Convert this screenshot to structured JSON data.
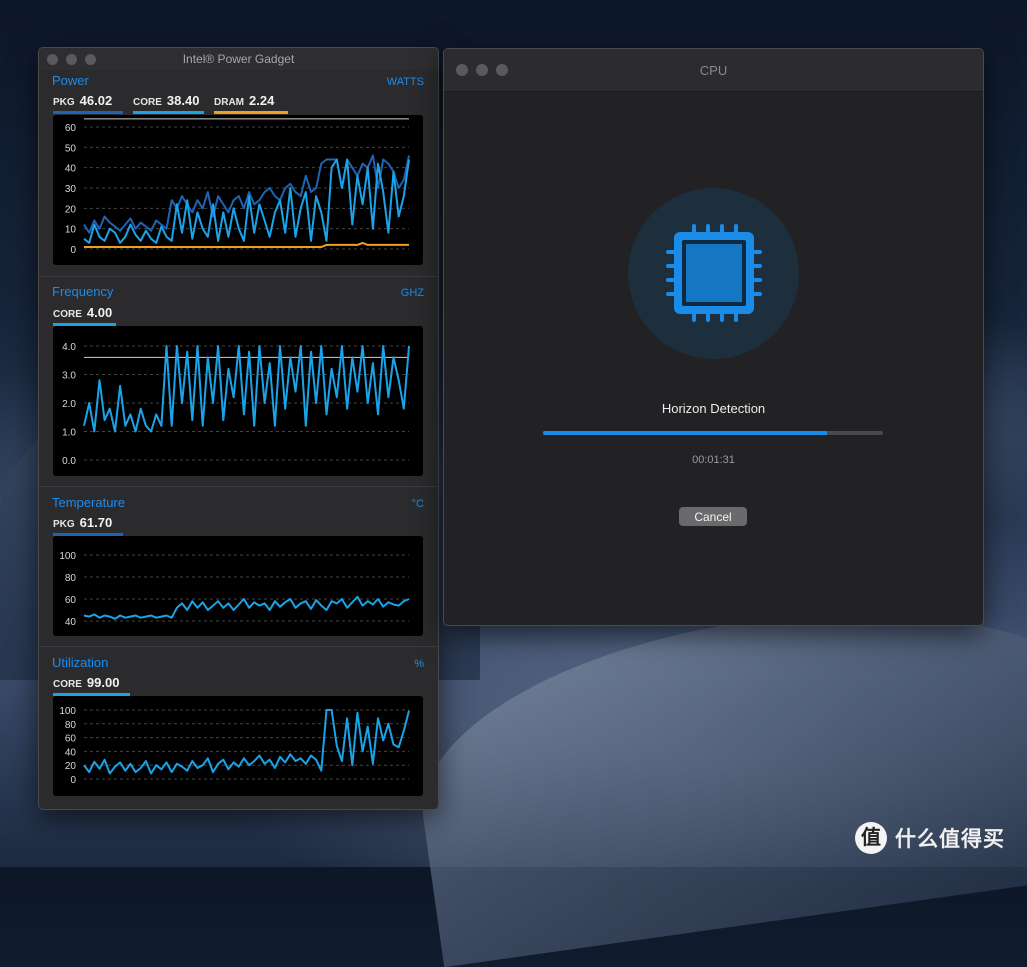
{
  "power_gadget": {
    "title": "Intel® Power Gadget",
    "power": {
      "title": "Power",
      "unit": "WATTS",
      "metrics": [
        {
          "label": "PKG",
          "value": "46.02",
          "color": "#1f63b5"
        },
        {
          "label": "CORE",
          "value": "38.40",
          "color": "#1aa3e8"
        },
        {
          "label": "DRAM",
          "value": "2.24",
          "color": "#f0a020"
        }
      ],
      "ticks": [
        "60",
        "50",
        "40",
        "30",
        "20",
        "10",
        "0"
      ]
    },
    "frequency": {
      "title": "Frequency",
      "unit": "GHZ",
      "metrics": [
        {
          "label": "CORE",
          "value": "4.00",
          "color": "#1aa3e8"
        }
      ],
      "ticks": [
        "4.0",
        "3.0",
        "2.0",
        "1.0",
        "0.0"
      ]
    },
    "temperature": {
      "title": "Temperature",
      "unit": "°C",
      "metrics": [
        {
          "label": "PKG",
          "value": "61.70",
          "color": "#1f63b5"
        }
      ],
      "ticks": [
        "100",
        "80",
        "60",
        "40"
      ]
    },
    "utilization": {
      "title": "Utilization",
      "unit": "%",
      "metrics": [
        {
          "label": "CORE",
          "value": "99.00",
          "color": "#1aa3e8"
        }
      ],
      "ticks": [
        "100",
        "80",
        "60",
        "40",
        "20",
        "0"
      ]
    }
  },
  "chart_data": [
    {
      "type": "line",
      "ylim": [
        0,
        65
      ],
      "series": [
        {
          "name": "PKG",
          "color": "#1f63b5",
          "values": [
            12,
            8,
            14,
            10,
            16,
            13,
            11,
            9,
            12,
            15,
            10,
            13,
            11,
            9,
            14,
            12,
            10,
            24,
            20,
            26,
            22,
            18,
            24,
            20,
            28,
            16,
            26,
            22,
            18,
            24,
            26,
            20,
            28,
            22,
            24,
            28,
            30,
            26,
            24,
            30,
            32,
            28,
            26,
            36,
            28,
            30,
            42,
            44,
            44,
            44,
            30,
            44,
            40,
            36,
            42,
            40,
            46,
            30,
            44,
            42,
            38,
            30,
            34,
            46
          ]
        },
        {
          "name": "CORE",
          "color": "#1aa3e8",
          "values": [
            5,
            3,
            12,
            6,
            4,
            10,
            8,
            3,
            6,
            12,
            7,
            4,
            9,
            5,
            3,
            11,
            6,
            4,
            22,
            8,
            24,
            5,
            18,
            10,
            6,
            22,
            4,
            18,
            6,
            20,
            10,
            4,
            26,
            8,
            22,
            14,
            6,
            18,
            24,
            8,
            30,
            6,
            20,
            28,
            4,
            26,
            18,
            4,
            40,
            44,
            30,
            44,
            12,
            36,
            22,
            40,
            10,
            42,
            28,
            8,
            38,
            16,
            26,
            44
          ]
        },
        {
          "name": "DRAM",
          "color": "#f0a020",
          "values": [
            1,
            1,
            1,
            1,
            1,
            1,
            1,
            1,
            1,
            1,
            1,
            1,
            1,
            1,
            1,
            1,
            1,
            1,
            1,
            1,
            1,
            1,
            1,
            1,
            1,
            1,
            1,
            1,
            1,
            1,
            1,
            1,
            1,
            1,
            1,
            1,
            1,
            1,
            1,
            1,
            1,
            1,
            1,
            1,
            1,
            1,
            1,
            2,
            2,
            2,
            2,
            2,
            2,
            2,
            3,
            2,
            2,
            2,
            2,
            2,
            2,
            2,
            2,
            2
          ]
        }
      ],
      "reference_line": 64
    },
    {
      "type": "line",
      "ylim": [
        0,
        4.4
      ],
      "series": [
        {
          "name": "CORE",
          "color": "#1aa3e8",
          "values": [
            1.2,
            2.0,
            1.0,
            2.8,
            1.4,
            1.8,
            1.0,
            2.6,
            1.2,
            1.6,
            1.0,
            1.8,
            1.2,
            1.0,
            1.6,
            1.2,
            4.1,
            1.2,
            4.1,
            2.0,
            3.8,
            1.4,
            4.0,
            1.2,
            3.6,
            2.0,
            4.0,
            1.4,
            3.2,
            2.2,
            4.0,
            1.6,
            3.8,
            1.2,
            4.1,
            2.0,
            3.4,
            1.2,
            4.0,
            1.8,
            3.6,
            2.4,
            4.1,
            1.2,
            3.8,
            2.0,
            4.0,
            1.6,
            3.2,
            2.2,
            4.0,
            1.8,
            3.6,
            2.4,
            4.1,
            2.0,
            3.4,
            1.6,
            4.0,
            2.2,
            3.6,
            2.8,
            1.8,
            4.0
          ]
        }
      ],
      "reference_line": 3.6
    },
    {
      "type": "line",
      "ylim": [
        35,
        105
      ],
      "series": [
        {
          "name": "PKG",
          "color": "#1aa3e8",
          "values": [
            45,
            44,
            46,
            43,
            45,
            44,
            42,
            45,
            43,
            44,
            45,
            43,
            44,
            45,
            43,
            44,
            45,
            43,
            52,
            56,
            50,
            58,
            52,
            57,
            50,
            54,
            58,
            52,
            56,
            50,
            55,
            60,
            52,
            57,
            54,
            56,
            50,
            58,
            53,
            57,
            60,
            52,
            56,
            58,
            51,
            59,
            54,
            50,
            58,
            56,
            60,
            52,
            57,
            62,
            54,
            58,
            55,
            60,
            53,
            57,
            55,
            54,
            58,
            60
          ]
        }
      ]
    },
    {
      "type": "line",
      "ylim": [
        0,
        110
      ],
      "series": [
        {
          "name": "CORE",
          "color": "#1aa3e8",
          "values": [
            20,
            10,
            25,
            15,
            28,
            8,
            18,
            24,
            12,
            22,
            10,
            16,
            26,
            8,
            20,
            14,
            24,
            10,
            22,
            18,
            12,
            26,
            16,
            20,
            30,
            10,
            22,
            28,
            14,
            24,
            18,
            30,
            20,
            26,
            34,
            22,
            28,
            16,
            32,
            24,
            36,
            26,
            30,
            22,
            34,
            28,
            12,
            100,
            100,
            48,
            26,
            88,
            20,
            96,
            40,
            76,
            22,
            88,
            56,
            80,
            50,
            46,
            70,
            99
          ]
        }
      ]
    }
  ],
  "cpu_window": {
    "title": "CPU",
    "task_label": "Horizon Detection",
    "progress": 0.835,
    "elapsed": "00:01:31",
    "cancel_label": "Cancel",
    "accent": "#1a8ce8"
  },
  "watermark": {
    "text": "什么值得买",
    "logo": "值"
  }
}
